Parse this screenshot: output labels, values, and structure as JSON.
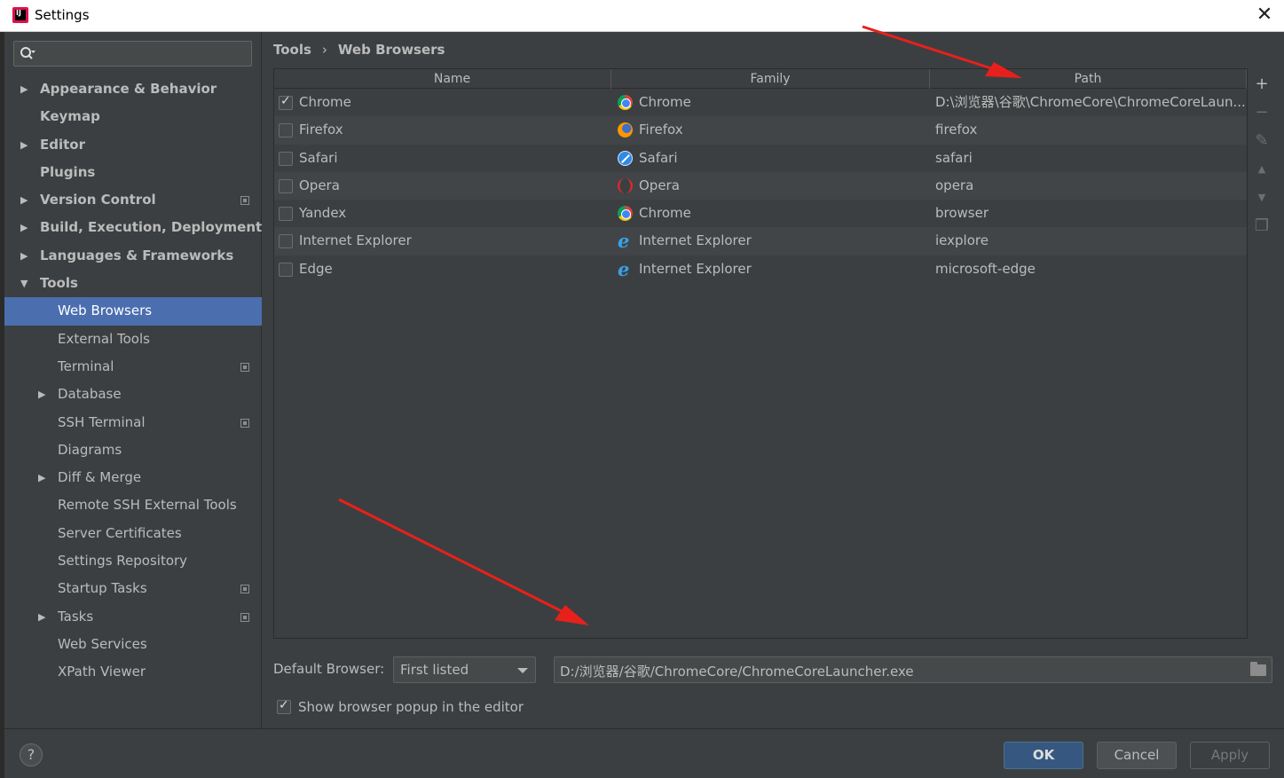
{
  "window": {
    "title": "Settings",
    "close_glyph": "✕"
  },
  "search": {
    "placeholder": ""
  },
  "sidebar": {
    "items": [
      {
        "label": "Appearance & Behavior",
        "level": 0,
        "arrow": "▶",
        "bold": true
      },
      {
        "label": "Keymap",
        "level": 0,
        "arrow": "",
        "bold": true
      },
      {
        "label": "Editor",
        "level": 0,
        "arrow": "▶",
        "bold": true
      },
      {
        "label": "Plugins",
        "level": 0,
        "arrow": "",
        "bold": true
      },
      {
        "label": "Version Control",
        "level": 0,
        "arrow": "▶",
        "bold": true,
        "project": true
      },
      {
        "label": "Build, Execution, Deployment",
        "level": 0,
        "arrow": "▶",
        "bold": true
      },
      {
        "label": "Languages & Frameworks",
        "level": 0,
        "arrow": "▶",
        "bold": true
      },
      {
        "label": "Tools",
        "level": 0,
        "arrow": "▼",
        "bold": true
      },
      {
        "label": "Web Browsers",
        "level": 1,
        "arrow": "",
        "selected": true
      },
      {
        "label": "External Tools",
        "level": 1,
        "arrow": ""
      },
      {
        "label": "Terminal",
        "level": 1,
        "arrow": "",
        "project": true
      },
      {
        "label": "Database",
        "level": 1,
        "arrow": "▶"
      },
      {
        "label": "SSH Terminal",
        "level": 1,
        "arrow": "",
        "project": true
      },
      {
        "label": "Diagrams",
        "level": 1,
        "arrow": ""
      },
      {
        "label": "Diff & Merge",
        "level": 1,
        "arrow": "▶"
      },
      {
        "label": "Remote SSH External Tools",
        "level": 1,
        "arrow": ""
      },
      {
        "label": "Server Certificates",
        "level": 1,
        "arrow": ""
      },
      {
        "label": "Settings Repository",
        "level": 1,
        "arrow": ""
      },
      {
        "label": "Startup Tasks",
        "level": 1,
        "arrow": "",
        "project": true
      },
      {
        "label": "Tasks",
        "level": 1,
        "arrow": "▶",
        "project": true
      },
      {
        "label": "Web Services",
        "level": 1,
        "arrow": ""
      },
      {
        "label": "XPath Viewer",
        "level": 1,
        "arrow": ""
      }
    ]
  },
  "breadcrumb": {
    "parent": "Tools",
    "separator": "›",
    "current": "Web Browsers"
  },
  "table": {
    "columns": [
      "Name",
      "Family",
      "Path"
    ],
    "rows": [
      {
        "checked": true,
        "name": "Chrome",
        "family": "Chrome",
        "family_icon": "chrome-icon",
        "path": "D:\\浏览器\\谷歌\\ChromeCore\\ChromeCoreLaun..."
      },
      {
        "checked": false,
        "name": "Firefox",
        "family": "Firefox",
        "family_icon": "firefox-icon",
        "path": "firefox"
      },
      {
        "checked": false,
        "name": "Safari",
        "family": "Safari",
        "family_icon": "safari-icon",
        "path": "safari"
      },
      {
        "checked": false,
        "name": "Opera",
        "family": "Opera",
        "family_icon": "opera-icon",
        "path": "opera"
      },
      {
        "checked": false,
        "name": "Yandex",
        "family": "Chrome",
        "family_icon": "chrome-icon",
        "path": "browser"
      },
      {
        "checked": false,
        "name": "Internet Explorer",
        "family": "Internet Explorer",
        "family_icon": "ie-icon",
        "path": "iexplore"
      },
      {
        "checked": false,
        "name": "Edge",
        "family": "Internet Explorer",
        "family_icon": "ie-icon",
        "path": "microsoft-edge"
      }
    ]
  },
  "side_tools": [
    {
      "name": "add-icon",
      "glyph": "+"
    },
    {
      "name": "remove-icon",
      "glyph": "−"
    },
    {
      "name": "edit-icon",
      "glyph": "✎"
    },
    {
      "name": "move-up-icon",
      "glyph": "▲"
    },
    {
      "name": "move-down-icon",
      "glyph": "▼"
    },
    {
      "name": "copy-icon",
      "glyph": "❐"
    }
  ],
  "default_browser": {
    "label": "Default Browser:",
    "selected": "First listed",
    "path": "D:/浏览器/谷歌/ChromeCore/ChromeCoreLauncher.exe"
  },
  "popup_option": {
    "checked": true,
    "label": "Show browser popup in the editor"
  },
  "buttons": {
    "help": "?",
    "ok": "OK",
    "cancel": "Cancel",
    "apply": "Apply"
  },
  "colors": {
    "accent": "#4b6eaf",
    "ok_button": "#365880",
    "annotation_arrow": "#e8201c"
  }
}
